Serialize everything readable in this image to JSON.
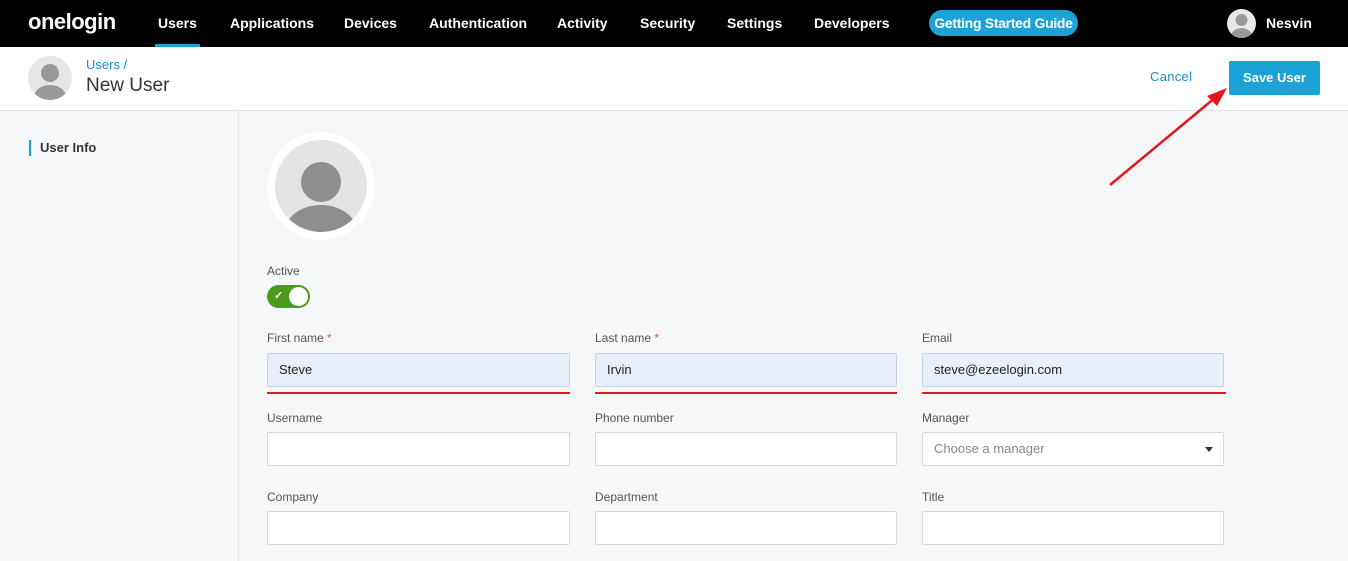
{
  "brand": "onelogin",
  "nav": {
    "items": [
      "Users",
      "Applications",
      "Devices",
      "Authentication",
      "Activity",
      "Security",
      "Settings",
      "Developers"
    ],
    "active": "Users",
    "guide_label": "Getting Started Guide",
    "user_name": "Nesvin"
  },
  "header": {
    "breadcrumb": "Users /",
    "title": "New User",
    "cancel_label": "Cancel",
    "save_label": "Save User"
  },
  "sidebar": {
    "items": [
      {
        "label": "User Info",
        "active": true
      }
    ]
  },
  "form": {
    "active_label": "Active",
    "active": true,
    "first_name": {
      "label": "First name",
      "required": "*",
      "value": "Steve"
    },
    "last_name": {
      "label": "Last name",
      "required": "*",
      "value": "Irvin"
    },
    "email": {
      "label": "Email",
      "value": "steve@ezeelogin.com"
    },
    "username": {
      "label": "Username",
      "value": ""
    },
    "phone": {
      "label": "Phone number",
      "value": ""
    },
    "manager": {
      "label": "Manager",
      "placeholder": "Choose a manager"
    },
    "company": {
      "label": "Company",
      "value": ""
    },
    "department": {
      "label": "Department",
      "value": ""
    },
    "title": {
      "label": "Title",
      "value": ""
    }
  },
  "colors": {
    "accent": "#1ba2d7",
    "toggle_on": "#4a9b1a",
    "annotation": "#e5161b",
    "nav_bg": "#000000"
  }
}
